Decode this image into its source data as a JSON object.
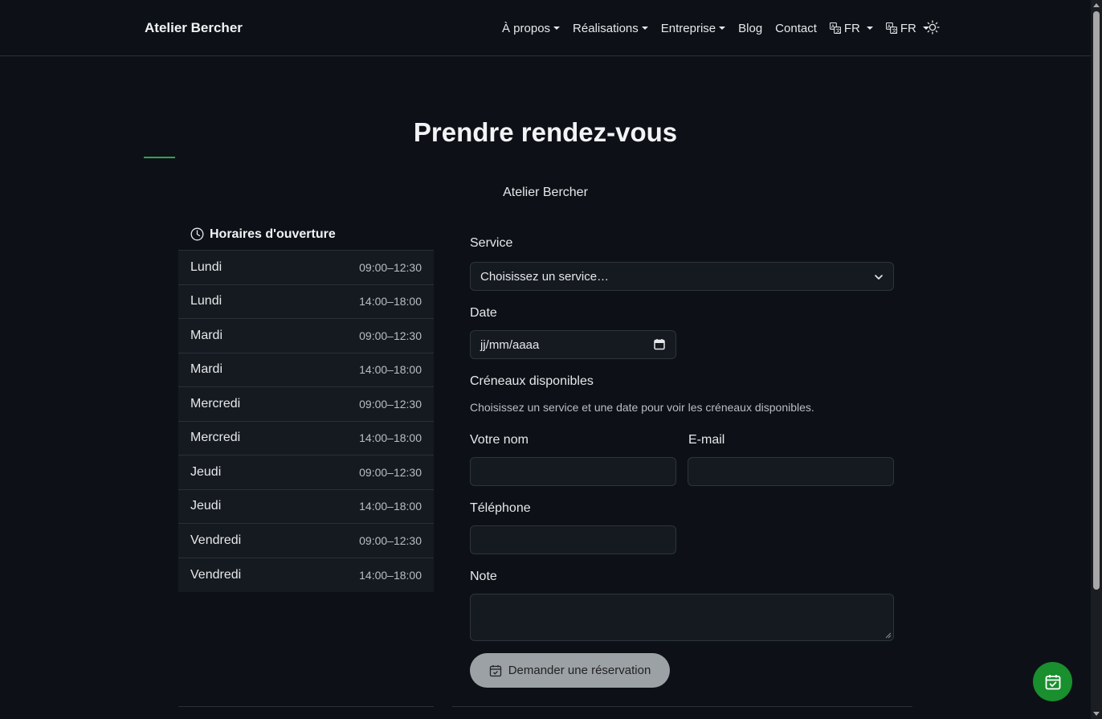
{
  "nav": {
    "brand": "Atelier Bercher",
    "items": [
      {
        "label": "À propos",
        "dropdown": true
      },
      {
        "label": "Réalisations",
        "dropdown": true
      },
      {
        "label": "Entreprise",
        "dropdown": true
      },
      {
        "label": "Blog",
        "dropdown": false
      },
      {
        "label": "Contact",
        "dropdown": false
      }
    ],
    "lang1": "FR",
    "lang2": "FR"
  },
  "page": {
    "title": "Prendre rendez-vous",
    "subtitle": "Atelier Bercher"
  },
  "hours": {
    "title": "Horaires d'ouverture",
    "rows": [
      {
        "day": "Lundi",
        "time": "09:00–12:30"
      },
      {
        "day": "Lundi",
        "time": "14:00–18:00"
      },
      {
        "day": "Mardi",
        "time": "09:00–12:30"
      },
      {
        "day": "Mardi",
        "time": "14:00–18:00"
      },
      {
        "day": "Mercredi",
        "time": "09:00–12:30"
      },
      {
        "day": "Mercredi",
        "time": "14:00–18:00"
      },
      {
        "day": "Jeudi",
        "time": "09:00–12:30"
      },
      {
        "day": "Jeudi",
        "time": "14:00–18:00"
      },
      {
        "day": "Vendredi",
        "time": "09:00–12:30"
      },
      {
        "day": "Vendredi",
        "time": "14:00–18:00"
      }
    ]
  },
  "form": {
    "service_label": "Service",
    "service_value": "Choisissez un service…",
    "date_label": "Date",
    "date_placeholder": "jj/mm/aaaa",
    "slots_label": "Créneaux disponibles",
    "slots_hint": "Choisissez un service et une date pour voir les créneaux disponibles.",
    "name_label": "Votre nom",
    "email_label": "E-mail",
    "phone_label": "Téléphone",
    "note_label": "Note",
    "submit_label": "Demander une réservation"
  },
  "colors": {
    "background": "#0d1117",
    "accent": "#2ea44f",
    "fab": "#198f2e"
  }
}
